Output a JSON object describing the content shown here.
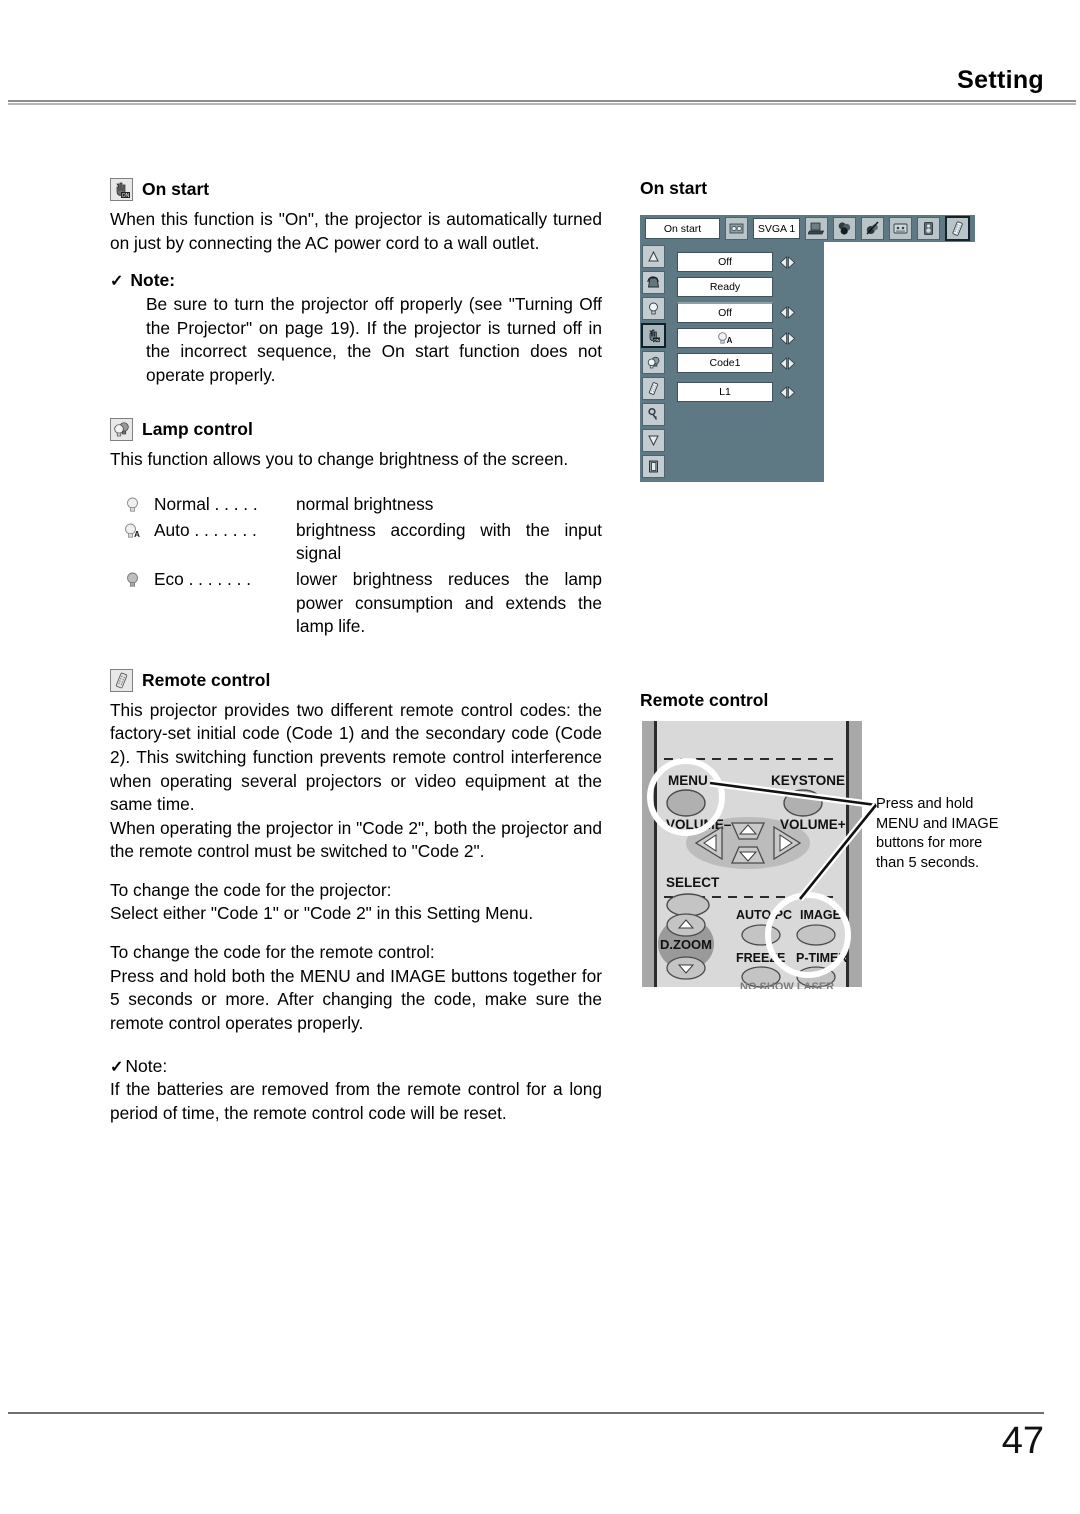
{
  "header": {
    "title": "Setting"
  },
  "footer": {
    "page_number": "47"
  },
  "sections": {
    "on_start": {
      "icon": "hand-on-icon",
      "heading": "On start",
      "body": "When this function is \"On\", the projector is automatically turned on just by connecting the AC power cord to a wall outlet.",
      "note_label": "Note:",
      "note_body": "Be sure to turn the projector off properly (see \"Turning Off the Projector\" on page 19).  If the projector is turned off in the incorrect sequence, the On start function does not operate properly."
    },
    "lamp_control": {
      "icon": "lamp-control-icon",
      "heading": "Lamp control",
      "body": "This function allows you to change brightness of the screen.",
      "modes": [
        {
          "icon": "lamp-normal-icon",
          "name": "Normal . . . . .",
          "desc": "normal brightness"
        },
        {
          "icon": "lamp-auto-icon",
          "name": "Auto . . . . . . .",
          "desc": "brightness according with the input  signal"
        },
        {
          "icon": "lamp-eco-icon",
          "name": "Eco  . . . . . . .",
          "desc": "lower brightness reduces the lamp power consumption and extends the lamp life."
        }
      ]
    },
    "remote_control": {
      "icon": "remote-control-icon",
      "heading": "Remote control",
      "body1": "This projector provides two different remote control codes: the factory-set initial code (Code 1) and the secondary code (Code 2).  This switching function prevents remote control interference when operating several projectors or video equipment at the same time.",
      "body2": "When operating the projector in \"Code 2\", both the projector and the remote control must be switched to \"Code 2\".",
      "proj_head": "To change the code for the projector:",
      "proj_body": "Select either \"Code 1\" or \"Code 2\" in this Setting Menu.",
      "rc_head": "To change the code for the remote control:",
      "rc_body": "Press and hold both the MENU and IMAGE buttons together for 5 seconds or more.  After changing the code, make sure the  remote control operates properly.",
      "note_label": "Note:",
      "note_body": "If the batteries are removed from the remote control for a long period of time, the remote control code will be reset."
    }
  },
  "osd": {
    "title": "On start",
    "menu_name": "On start",
    "input_source": "SVGA 1",
    "top_icons": [
      "setting-gear-icon",
      "computer-icon",
      "color-icon",
      "image-adjust-icon",
      "screen-icon",
      "sound-icon",
      "remote-setting-icon"
    ],
    "side_icons": [
      "scroll-up-icon",
      "keystone-icon",
      "lamp-icon",
      "on-start-icon",
      "lamp-control-icon",
      "remote-icon",
      "security-key-icon",
      "scroll-down-icon",
      "exit-icon"
    ],
    "rows": [
      {
        "name": "standby-mode",
        "value": "Off",
        "has_arrows": true
      },
      {
        "name": "power-management",
        "value": "Ready",
        "has_arrows": false
      },
      {
        "name": "on-start",
        "value": "Off",
        "has_arrows": true
      },
      {
        "name": "lamp-control",
        "value": "",
        "icon": "lamp-auto-icon",
        "has_arrows": true
      },
      {
        "name": "remote-control-code",
        "value": "Code1",
        "has_arrows": true
      },
      {
        "name": "logo-select",
        "value": "L1",
        "has_arrows": true
      }
    ]
  },
  "remote_diagram": {
    "title": "Remote control",
    "callout": "Press and hold MENU and IMAGE buttons for more than 5 seconds.",
    "buttons": {
      "menu": "MENU",
      "keystone": "KEYSTONE",
      "volume_minus": "VOLUME–",
      "volume_plus": "VOLUME+",
      "select": "SELECT",
      "auto_pc": "AUTO PC",
      "image": "IMAGE",
      "d_zoom": "D.ZOOM",
      "freeze": "FREEZE",
      "p_timer": "P-TIMER"
    }
  },
  "colors": {
    "osd_panel": "#5f7984",
    "osd_field": "#ffffff",
    "rule": "#8d8d8d",
    "remote_body": "#d8d8d8"
  }
}
